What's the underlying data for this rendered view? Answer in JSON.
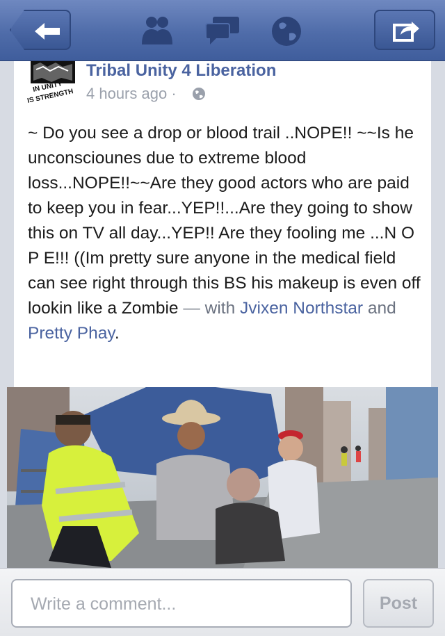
{
  "header": {
    "icons": [
      "back-arrow-icon",
      "friends-icon",
      "messages-icon",
      "notifications-globe-icon",
      "share-icon"
    ]
  },
  "post": {
    "page_name": "Tribal Unity 4 Liberation",
    "time": "4 hours ago",
    "separator": "·",
    "avatar_text": "IN UNITY IS STRENGTH",
    "text": "~ Do you see a drop or blood trail ..NOPE!! ~~Is he unconsciounes due to extreme blood loss...NOPE!!~~Are they good actors who are paid to keep you in fear...YEP!!...Are they going to show this on TV all day...YEP!! Are they fooling me ...N O P E!!! ((Im pretty sure anyone in the medical field can see right through this BS his makeup is even off lookin like a Zombie",
    "with_dash": "—",
    "with_word": "with",
    "tag1": "Jvixen Northstar",
    "and_word": "and",
    "tag2": "Pretty Phay",
    "end_period": "."
  },
  "comment": {
    "placeholder": "Write a comment...",
    "post_label": "Post"
  },
  "colors": {
    "header_blue": "#4f6ca9",
    "link_blue": "#4a63a0"
  }
}
